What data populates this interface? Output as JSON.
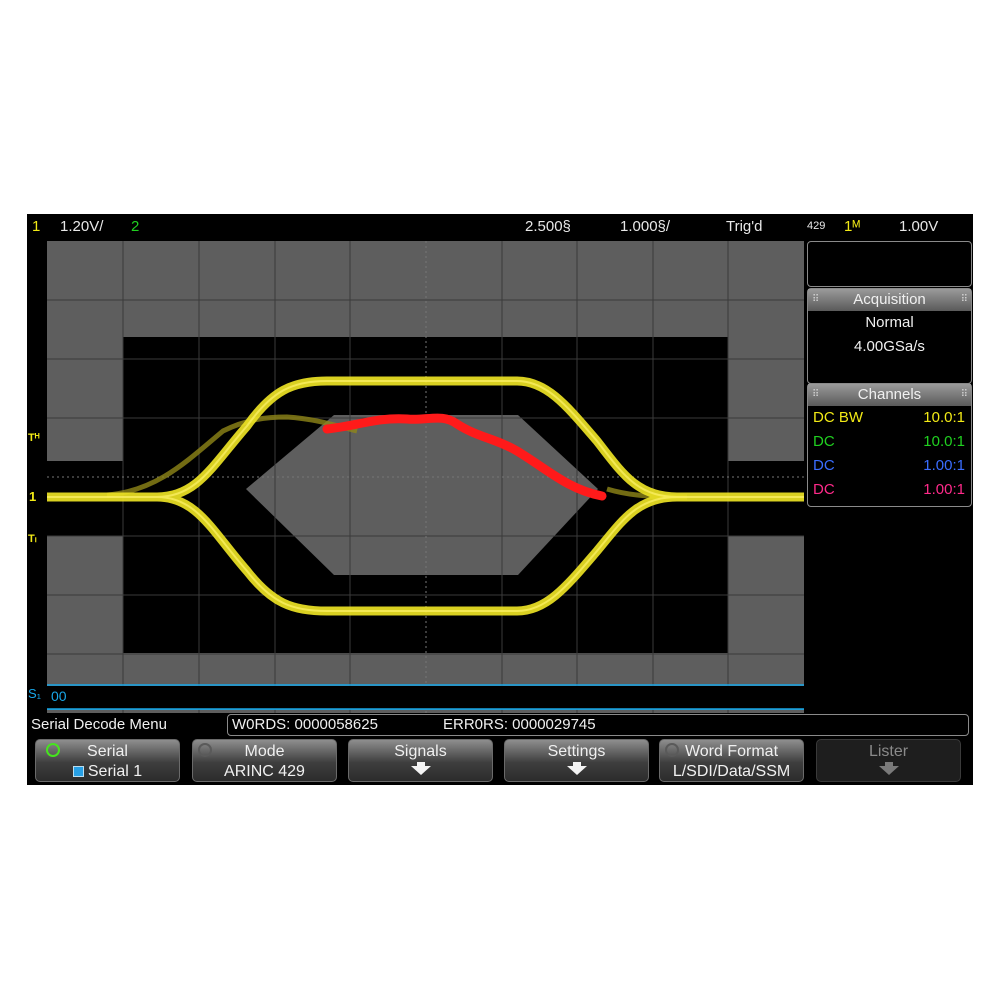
{
  "status_bar": {
    "ch1_num": "1",
    "ch1_scale": "1.20V/",
    "ch2_num": "2",
    "time_delay": "2.500§",
    "time_scale": "1.000§/",
    "trigger_status": "Trig'd",
    "trigger_source": "429",
    "trigger_channel": "1ᴹ",
    "trigger_level": "1.00V"
  },
  "side_markers": {
    "ref_high": "Tᴴ",
    "ch1": "1",
    "ref_low": "Tₗ",
    "serial": "S₁"
  },
  "serial_lane": {
    "value": "00"
  },
  "acquisition": {
    "header": "Acquisition",
    "mode": "Normal",
    "sample_rate": "4.00GSa/s"
  },
  "channels": {
    "header": "Channels",
    "rows": [
      {
        "coupling": "DC BW",
        "probe": "10.0:1",
        "color": "#f2ea16"
      },
      {
        "coupling": "DC",
        "probe": "10.0:1",
        "color": "#20d020"
      },
      {
        "coupling": "DC",
        "probe": "1.00:1",
        "color": "#3a6dff"
      },
      {
        "coupling": "DC",
        "probe": "1.00:1",
        "color": "#ff2a8a"
      }
    ]
  },
  "menu_title": "Serial Decode Menu",
  "counters": {
    "words": "W0RDS: 0000058625",
    "errors": "ERR0RS: 0000029745"
  },
  "softkeys": {
    "serial": {
      "label": "Serial",
      "value": "Serial 1"
    },
    "mode": {
      "label": "Mode",
      "value": "ARINC 429"
    },
    "signals": {
      "label": "Signals"
    },
    "settings": {
      "label": "Settings"
    },
    "word_format": {
      "label": "Word Format",
      "value": "L/SDI/Data/SSM"
    },
    "lister": {
      "label": "Lister"
    }
  },
  "colors": {
    "ch1": "#f2ea16",
    "violation": "#ff1a1a",
    "mask": "#5e5e5e",
    "serial": "#19a7e8",
    "trigger_marker": "#f5902a"
  }
}
